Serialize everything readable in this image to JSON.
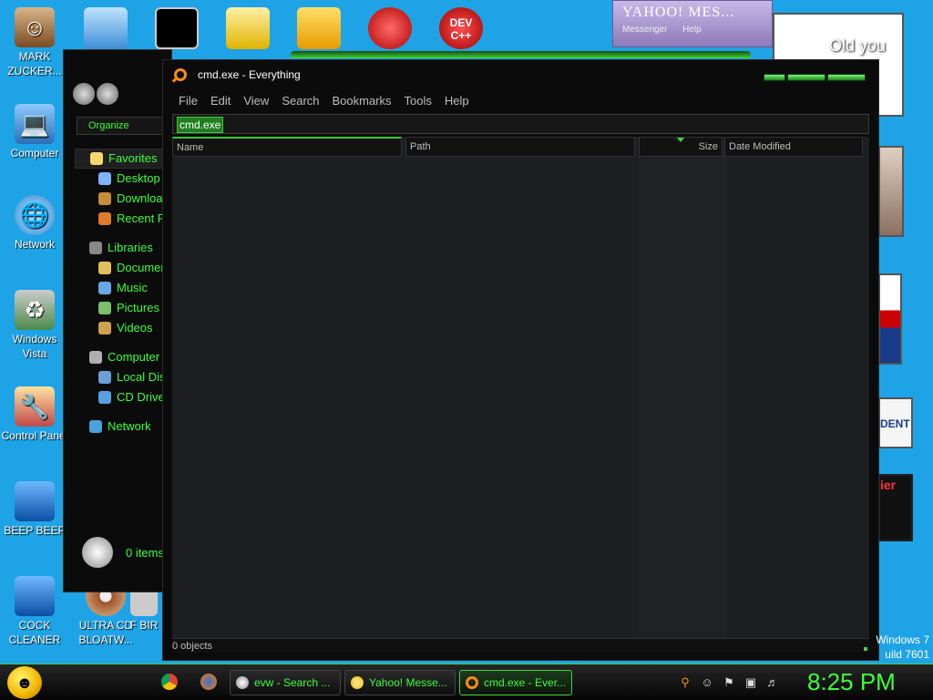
{
  "desktop": {
    "icons": [
      {
        "label": "MARK ZUCKER...",
        "icon": "person-icon"
      },
      {
        "label": "Computer",
        "icon": "computer-icon"
      },
      {
        "label": "Network",
        "icon": "network-icon"
      },
      {
        "label": "Windows Vista",
        "icon": "recycle-bin-icon"
      },
      {
        "label": "Control Panel",
        "icon": "control-panel-icon"
      },
      {
        "label": "BEEP BEEP",
        "icon": "folder-icon"
      },
      {
        "label": "COCK CLEANER",
        "icon": "folder-icon"
      },
      {
        "label": "ULTRA CD BLOATW...",
        "icon": "cd-icon"
      },
      {
        "label": "F BIR",
        "icon": "app-icon"
      }
    ],
    "top_icons": [
      "notepad-icon",
      "cmd-icon",
      "folder-icon",
      "bad-piggies-icon",
      "p-icon",
      "devcpp-icon"
    ],
    "devcpp_label": "DEV C++",
    "watermark_line1": "Windows 7",
    "watermark_line2": "uild 7601"
  },
  "yahoo": {
    "title": "YAHOO! MES...",
    "menu1": "Messenger",
    "menu2": "Help"
  },
  "bg_windows": {
    "old_you": "Old you",
    "dent": "DENT",
    "ier": "ier"
  },
  "explorer": {
    "organize": "Organize",
    "tree": [
      {
        "label": "Favorites",
        "level": "top",
        "icon": "star-icon"
      },
      {
        "label": "Desktop",
        "level": "sub",
        "icon": "desktop-icon"
      },
      {
        "label": "Downloads",
        "level": "sub",
        "icon": "downloads-icon"
      },
      {
        "label": "Recent Places",
        "level": "sub",
        "icon": "recent-icon"
      },
      {
        "label": "Libraries",
        "level": "top",
        "icon": "library-icon"
      },
      {
        "label": "Documents",
        "level": "sub",
        "icon": "documents-icon"
      },
      {
        "label": "Music",
        "level": "sub",
        "icon": "music-icon"
      },
      {
        "label": "Pictures",
        "level": "sub",
        "icon": "pictures-icon"
      },
      {
        "label": "Videos",
        "level": "sub",
        "icon": "videos-icon"
      },
      {
        "label": "Computer",
        "level": "top",
        "icon": "computer-icon"
      },
      {
        "label": "Local Disk",
        "level": "sub",
        "icon": "disk-icon"
      },
      {
        "label": "CD Drive",
        "level": "sub",
        "icon": "cd-icon"
      },
      {
        "label": "Network",
        "level": "top",
        "icon": "network-icon"
      }
    ],
    "item_count": "0 items"
  },
  "everything": {
    "title": "cmd.exe - Everything",
    "menu": [
      "File",
      "Edit",
      "View",
      "Search",
      "Bookmarks",
      "Tools",
      "Help"
    ],
    "search_value": "cmd.exe",
    "columns": [
      "Name",
      "Path",
      "Size",
      "Date Modified"
    ],
    "status": "0 objects"
  },
  "taskbar": {
    "tasks": [
      {
        "label": "evw - Search ...",
        "icon": "search-icon"
      },
      {
        "label": "Yahoo! Messe...",
        "icon": "yahoo-icon"
      },
      {
        "label": "cmd.exe - Ever...",
        "icon": "everything-icon"
      }
    ],
    "clock": "8:25 PM"
  },
  "colors": {
    "accent": "#3cff3c",
    "desktop": "#1ea3e6",
    "window": "#0b0b0b"
  }
}
